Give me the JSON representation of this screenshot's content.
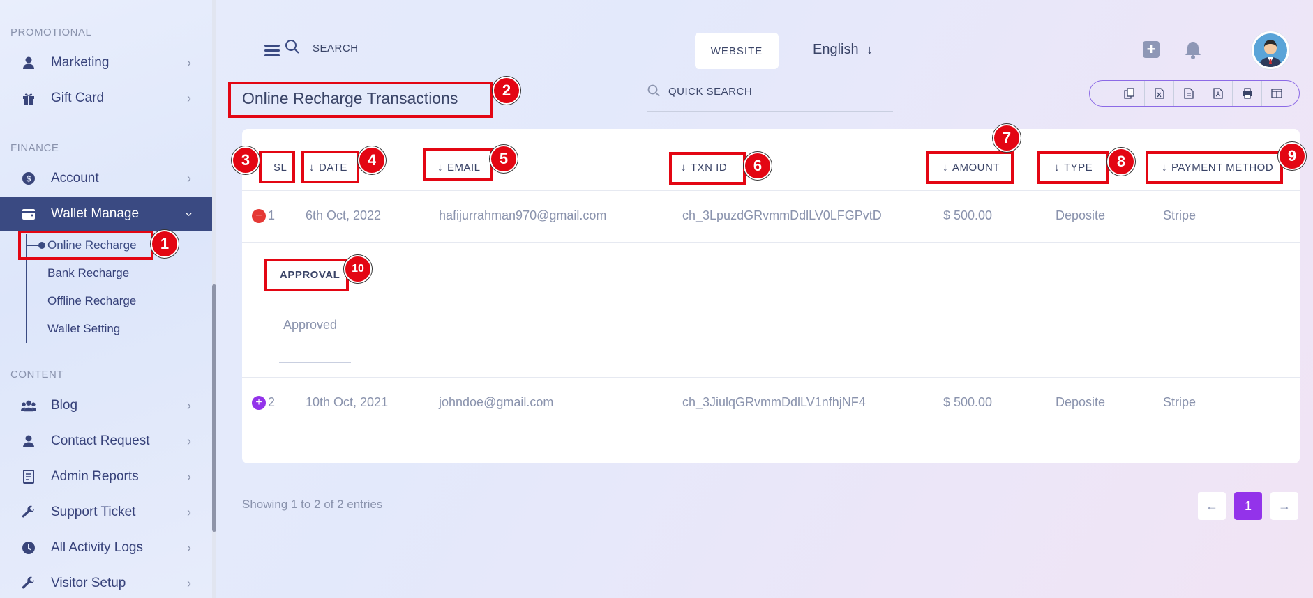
{
  "sidebar": {
    "sections": {
      "promotional": "PROMOTIONAL",
      "finance": "FINANCE",
      "content": "CONTENT"
    },
    "items": {
      "marketing": "Marketing",
      "gift_card": "Gift Card",
      "account": "Account",
      "wallet_manage": "Wallet Manage",
      "blog": "Blog",
      "contact_request": "Contact Request",
      "admin_reports": "Admin Reports",
      "support_ticket": "Support Ticket",
      "all_activity_logs": "All Activity Logs",
      "visitor_setup": "Visitor Setup"
    },
    "wallet_sub": {
      "online_recharge": "Online Recharge",
      "bank_recharge": "Bank Recharge",
      "offline_recharge": "Offline Recharge",
      "wallet_setting": "Wallet Setting"
    },
    "active_color": "#3a4a82"
  },
  "header": {
    "search_placeholder": "SEARCH",
    "website_label": "WEBSITE",
    "language": "English"
  },
  "page": {
    "title": "Online Recharge Transactions",
    "quick_search_placeholder": "QUICK SEARCH",
    "export_icons": [
      "copy-icon",
      "excel-icon",
      "csv-icon",
      "pdf-icon",
      "print-icon",
      "columns-icon"
    ]
  },
  "table": {
    "headers": {
      "sl": "SL",
      "date": "DATE",
      "email": "EMAIL",
      "txn_id": "TXN ID",
      "amount": "AMOUNT",
      "type": "TYPE",
      "payment_method": "PAYMENT METHOD"
    },
    "rows": [
      {
        "sl": "1",
        "date": "6th Oct, 2022",
        "email": "hafijurrahman970@gmail.com",
        "txn_id": "ch_3LpuzdGRvmmDdlLV0LFGPvtD",
        "amount": "$ 500.00",
        "type": "Deposite",
        "payment_method": "Stripe",
        "expanded": true
      },
      {
        "sl": "2",
        "date": "10th Oct, 2021",
        "email": "johndoe@gmail.com",
        "txn_id": "ch_3JiulqGRvmmDdlLV1nfhjNF4",
        "amount": "$ 500.00",
        "type": "Deposite",
        "payment_method": "Stripe",
        "expanded": false
      }
    ],
    "child": {
      "label": "APPROVAL",
      "value": "Approved"
    }
  },
  "footer": {
    "showing": "Showing 1 to 2 of 2 entries",
    "current_page": "1",
    "accent": "#9333ea"
  },
  "annotations": [
    "1",
    "2",
    "3",
    "4",
    "5",
    "6",
    "7",
    "8",
    "9",
    "10"
  ],
  "annotation_color": "#e30613"
}
